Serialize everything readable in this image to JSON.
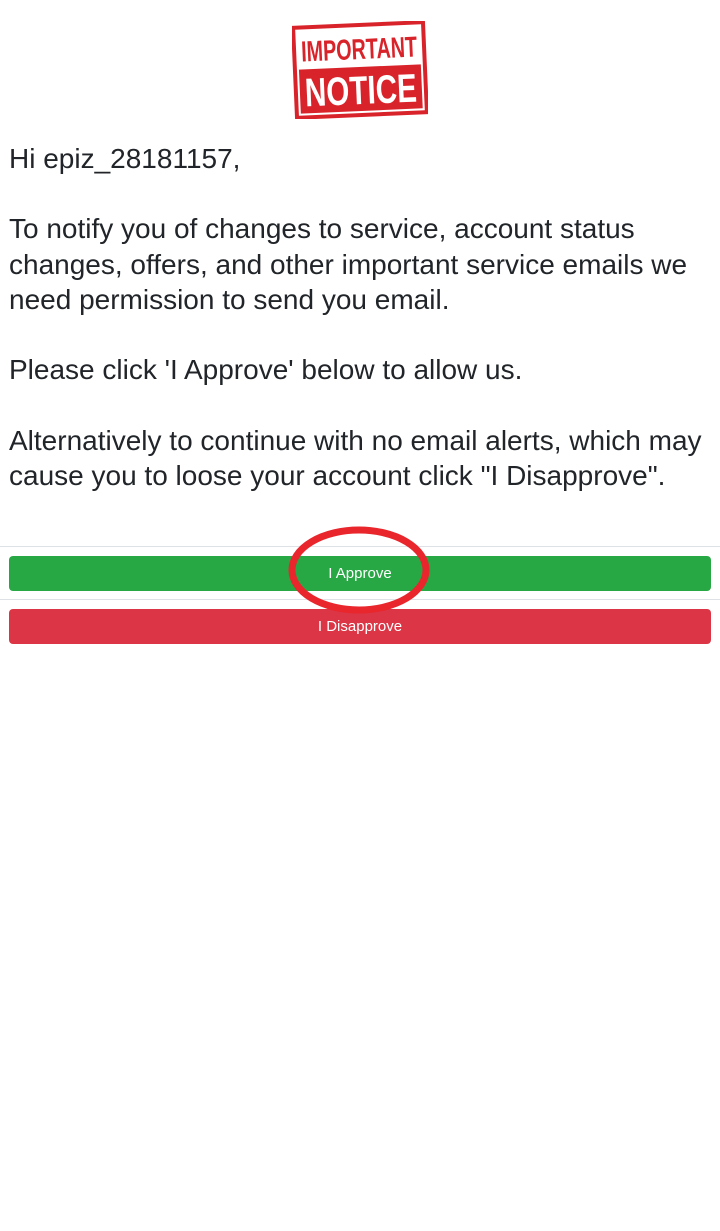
{
  "notice_logo": {
    "line1": "IMPORTANT",
    "line2": "NOTICE",
    "color": "#d9232a"
  },
  "message": {
    "greeting": "Hi epiz_28181157,",
    "paragraph1": "To notify you of changes to service, account status changes, offers, and other important service emails we need permission to send you email.",
    "paragraph2": "Please click 'I Approve' below to allow us.",
    "paragraph3": "Alternatively to continue with no email alerts, which may cause you to loose your account click \"I Disapprove\"."
  },
  "actions": {
    "approve_label": "I Approve",
    "disapprove_label": "I Disapprove",
    "approve_color": "#28a745",
    "disapprove_color": "#dc3545"
  },
  "annotation": {
    "shape": "circle",
    "color": "#e8262c",
    "target": "I Approve"
  }
}
